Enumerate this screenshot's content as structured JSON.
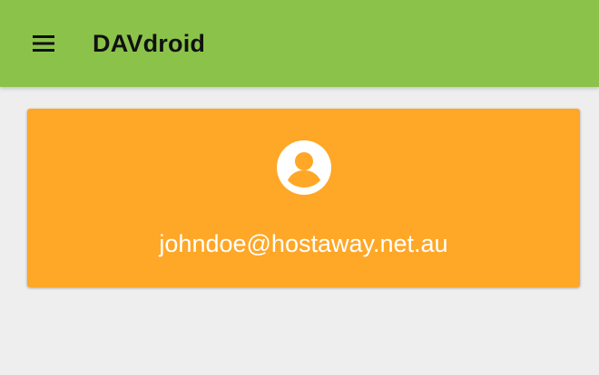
{
  "toolbar": {
    "title": "DAVdroid",
    "menu_icon": "hamburger-menu-icon",
    "background_color": "#8bc34a"
  },
  "accounts": [
    {
      "name": "johndoe@hostaway.net.au",
      "icon": "account-circle-icon",
      "card_color": "#ffa726"
    }
  ],
  "colors": {
    "background": "#eeeeee",
    "toolbar_text": "#111111",
    "card_text": "#ffffff"
  }
}
